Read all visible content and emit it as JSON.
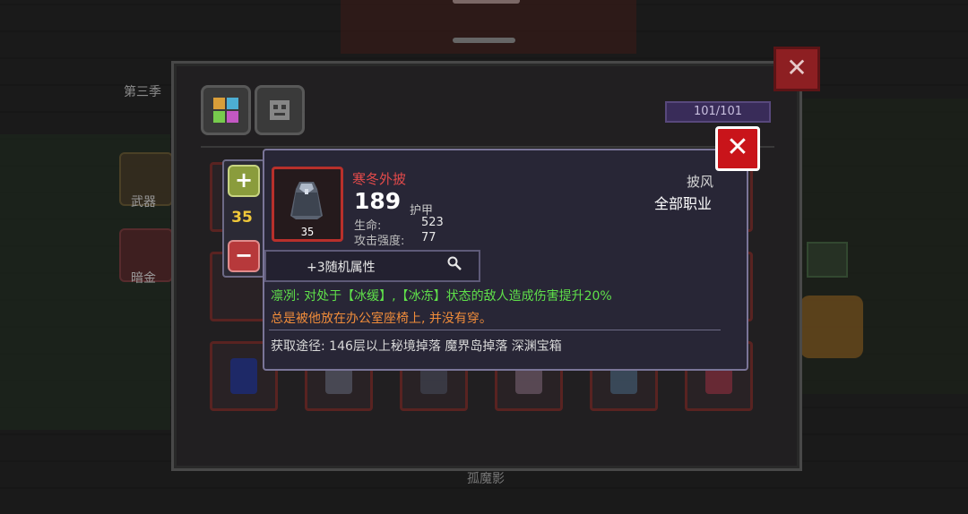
{
  "background": {
    "season_label": "第三季",
    "tabs": [
      {
        "label": "武器"
      },
      {
        "label": "暗金"
      }
    ],
    "bottom_name": "孤魔影"
  },
  "inventory": {
    "capacity": "101/101",
    "filters": [
      {
        "icon": "grid-icon"
      },
      {
        "icon": "armor-icon"
      }
    ],
    "slot_rows": 3,
    "slot_cols": 6,
    "close_icon": "close-icon"
  },
  "level_control": {
    "plus_label": "+",
    "level": "35",
    "minus_label": "−"
  },
  "tooltip": {
    "icon_level": "35",
    "name": "寒冬外披",
    "armor_value": "189",
    "armor_label": "护甲",
    "stats": [
      {
        "label": "生命:",
        "value": "523"
      },
      {
        "label": "攻击强度:",
        "value": "77"
      }
    ],
    "type": "披风",
    "class": "全部职业",
    "random_attr": "+3随机属性",
    "effect": "凛冽: 对处于【冰缓】,【冰冻】状态的敌人造成伤害提升20%",
    "flavor": "总是被他放在办公室座椅上, 并没有穿。",
    "source": "获取途径: 146层以上秘境掉落 魔界岛掉落 深渊宝箱",
    "close_label": "✕"
  },
  "colors": {
    "name_red": "#e24a4a",
    "effect_green": "#5fe04a",
    "flavor_orange": "#f08c3a",
    "level_gold": "#f0c83a",
    "close_red": "#c9141a"
  }
}
